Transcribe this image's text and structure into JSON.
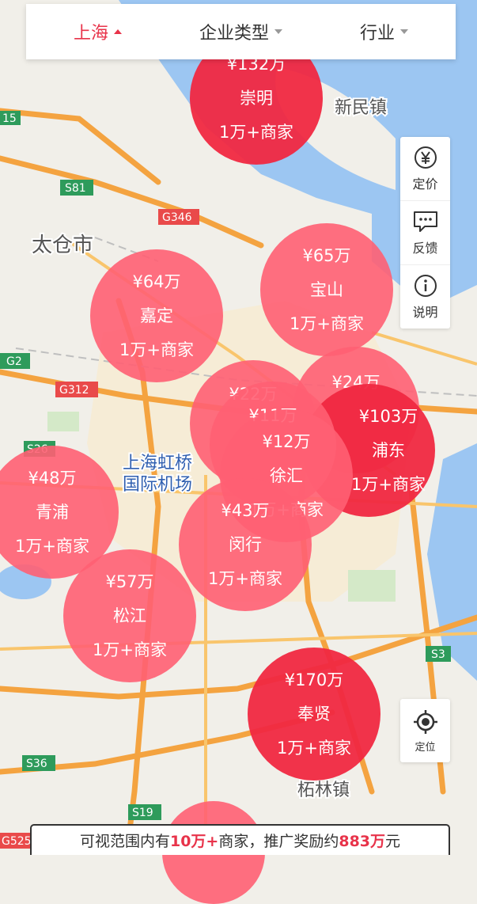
{
  "filters": {
    "region": "上海",
    "enterprise_type": "企业类型",
    "industry": "行业"
  },
  "tools": {
    "pricing_label": "定价",
    "feedback_label": "反馈",
    "info_label": "说明",
    "locate_label": "定位"
  },
  "map_labels": {
    "xinmin": "新民镇",
    "taicang": "太仓市",
    "hongqiao_1": "上海虹桥",
    "hongqiao_2": "国际机场",
    "zhelin": "柘林镇"
  },
  "road_labels": {
    "s15": "15",
    "s81": "S81",
    "g346": "G346",
    "g2": "G2",
    "g312": "G312",
    "s26": "S26",
    "s3": "S3",
    "s36": "S36",
    "s19": "S19",
    "g525": "G525"
  },
  "clusters": [
    {
      "price": "¥132万",
      "name": "崇明",
      "count": "1万+商家"
    },
    {
      "price": "¥65万",
      "name": "宝山",
      "count": "1万+商家"
    },
    {
      "price": "¥64万",
      "name": "嘉定",
      "count": "1万+商家"
    },
    {
      "price": "¥24万",
      "name": "",
      "count": ""
    },
    {
      "price": "¥22万",
      "name": "",
      "count": ""
    },
    {
      "price": "¥103万",
      "name": "浦东",
      "count": "1万+商家"
    },
    {
      "price": "¥11万",
      "name": "",
      "count": ""
    },
    {
      "price": "¥12万",
      "name": "徐汇",
      "count": "1万+商家"
    },
    {
      "price": "¥48万",
      "name": "青浦",
      "count": "1万+商家"
    },
    {
      "price": "¥43万",
      "name": "闵行",
      "count": "1万+商家"
    },
    {
      "price": "¥57万",
      "name": "松江",
      "count": "1万+商家"
    },
    {
      "price": "¥170万",
      "name": "奉贤",
      "count": "1万+商家"
    }
  ],
  "summary": {
    "prefix": "可视范围内有",
    "merchants": "10万+",
    "middle": "商家，推广奖励约",
    "reward": "883万",
    "suffix": "元"
  },
  "colors": {
    "accent": "#e8334a",
    "bubble_light": "#ff5f73",
    "bubble_dark": "#f02841",
    "water": "#9cc6f2"
  }
}
